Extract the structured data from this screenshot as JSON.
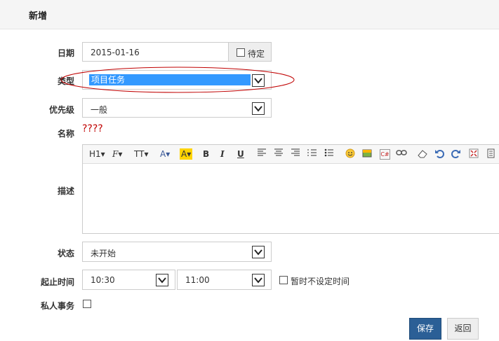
{
  "header": {
    "title": "新增"
  },
  "form": {
    "date": {
      "label": "日期",
      "value": "2015-01-16",
      "pending_label": "待定"
    },
    "type": {
      "label": "类型",
      "value": "项目任务"
    },
    "priority": {
      "label": "优先级",
      "value": "一般"
    },
    "name": {
      "label": "名称",
      "value": "????"
    },
    "description": {
      "label": "描述"
    },
    "status": {
      "label": "状态",
      "value": "未开始"
    },
    "time": {
      "label": "起止时间",
      "start": "10:30",
      "end": "11:00",
      "no_time_label": "暂时不设定时间"
    },
    "private": {
      "label": "私人事务"
    }
  },
  "editor": {
    "heading": "H1",
    "font_family": "F",
    "font_size": "TT",
    "font_color": "A",
    "highlight": "A",
    "bold": "B",
    "italic": "I",
    "underline": "U",
    "code": "C#"
  },
  "actions": {
    "save": "保存",
    "back": "返回"
  },
  "colors": {
    "accent": "#2b5f96",
    "selection": "#3399ff",
    "annotation": "#c00000"
  }
}
